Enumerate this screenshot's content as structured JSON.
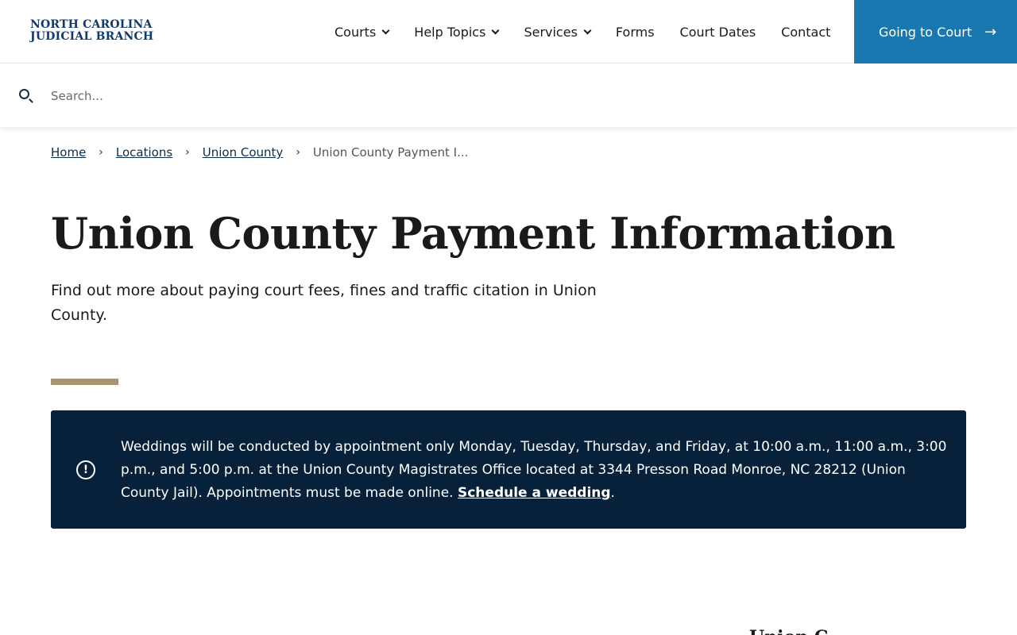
{
  "header": {
    "logo_line1": "NORTH CAROLINA",
    "logo_line2": "JUDICIAL BRANCH",
    "nav": [
      {
        "label": "Courts"
      },
      {
        "label": "Help Topics"
      },
      {
        "label": "Services"
      },
      {
        "label": "Forms"
      },
      {
        "label": "Court Dates"
      },
      {
        "label": "Contact"
      }
    ],
    "cta_label": "Going to Court",
    "cta_arrow": "→"
  },
  "search": {
    "placeholder": "Search...",
    "value": ""
  },
  "breadcrumb": {
    "items": [
      "Home",
      "Locations",
      "Union County"
    ],
    "separator": "›",
    "current": "Union County Payment I..."
  },
  "main": {
    "title": "Union County Payment Information",
    "subtitle": "Find out more about paying court fees, fines and traffic citation in Union County.",
    "accent_color": "#a89471"
  },
  "alert": {
    "icon": "!",
    "text": "Weddings will be conducted by appointment only Monday, Tuesday, Thursday, and Friday, at 10:00 a.m., 11:00 a.m., 3:00 p.m., and 5:00 p.m. at the Union County Magistrates Office located at 3344 Presson Road Monroe, NC 28212 (Union County Jail). Appointments must be made online. ",
    "link_label": "Schedule a wedding",
    "suffix": "."
  },
  "sidebar": {
    "heading_partial": "Union C..."
  },
  "colors": {
    "brand_blue": "#0f3a6b",
    "cta_blue": "#1a78b0",
    "alert_bg": "#08213a"
  }
}
